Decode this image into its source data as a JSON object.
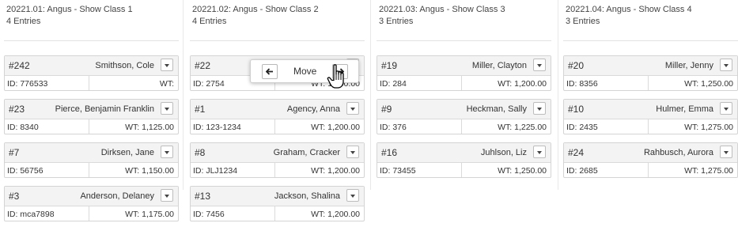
{
  "columns": [
    {
      "title": "20221.01: Angus - Show Class 1",
      "count": "4 Entries",
      "entries": [
        {
          "number": "#242",
          "name": "Smithson, Cole",
          "id": "ID: 776533",
          "wt": "WT:"
        },
        {
          "number": "#23",
          "name": "Pierce, Benjamin Franklin",
          "id": "ID: 8340",
          "wt": "WT: 1,125.00"
        },
        {
          "number": "#7",
          "name": "Dirksen, Jane",
          "id": "ID: 56756",
          "wt": "WT: 1,150.00"
        },
        {
          "number": "#3",
          "name": "Anderson, Delaney",
          "id": "ID: mca7898",
          "wt": "WT: 1,175.00"
        }
      ]
    },
    {
      "title": "20221.02: Angus - Show Class 2",
      "count": "4 Entries",
      "entries": [
        {
          "number": "#22",
          "name": "",
          "id": "ID: 2754",
          "wt": "WT: 1,200.00"
        },
        {
          "number": "#1",
          "name": "Agency, Anna",
          "id": "ID: 123-1234",
          "wt": "WT: 1,200.00"
        },
        {
          "number": "#8",
          "name": "Graham, Cracker",
          "id": "ID: JLJ1234",
          "wt": "WT: 1,200.00"
        },
        {
          "number": "#13",
          "name": "Jackson, Shalina",
          "id": "ID: 7456",
          "wt": "WT: 1,200.00"
        }
      ]
    },
    {
      "title": "20221.03: Angus - Show Class 3",
      "count": "3 Entries",
      "entries": [
        {
          "number": "#19",
          "name": "Miller, Clayton",
          "id": "ID: 284",
          "wt": "WT: 1,200.00"
        },
        {
          "number": "#9",
          "name": "Heckman, Sally",
          "id": "ID: 376",
          "wt": "WT: 1,225.00"
        },
        {
          "number": "#16",
          "name": "Juhlson, Liz",
          "id": "ID: 73455",
          "wt": "WT: 1,250.00"
        }
      ]
    },
    {
      "title": "20221.04: Angus - Show Class 4",
      "count": "3 Entries",
      "entries": [
        {
          "number": "#20",
          "name": "Miller, Jenny",
          "id": "ID: 8356",
          "wt": "WT: 1,250.00"
        },
        {
          "number": "#10",
          "name": "Hulmer, Emma",
          "id": "ID: 2435",
          "wt": "WT: 1,275.00"
        },
        {
          "number": "#24",
          "name": "Rahbusch, Aurora",
          "id": "ID: 2685",
          "wt": "WT: 1,275.00"
        }
      ]
    }
  ],
  "move_popover": {
    "label": "Move",
    "left_arrow": "🡐",
    "right_arrow": "",
    "icons": {
      "left": "arrow-left-icon",
      "right": "arrow-right-icon"
    }
  },
  "cursor_icon": "hand-pointer-icon"
}
